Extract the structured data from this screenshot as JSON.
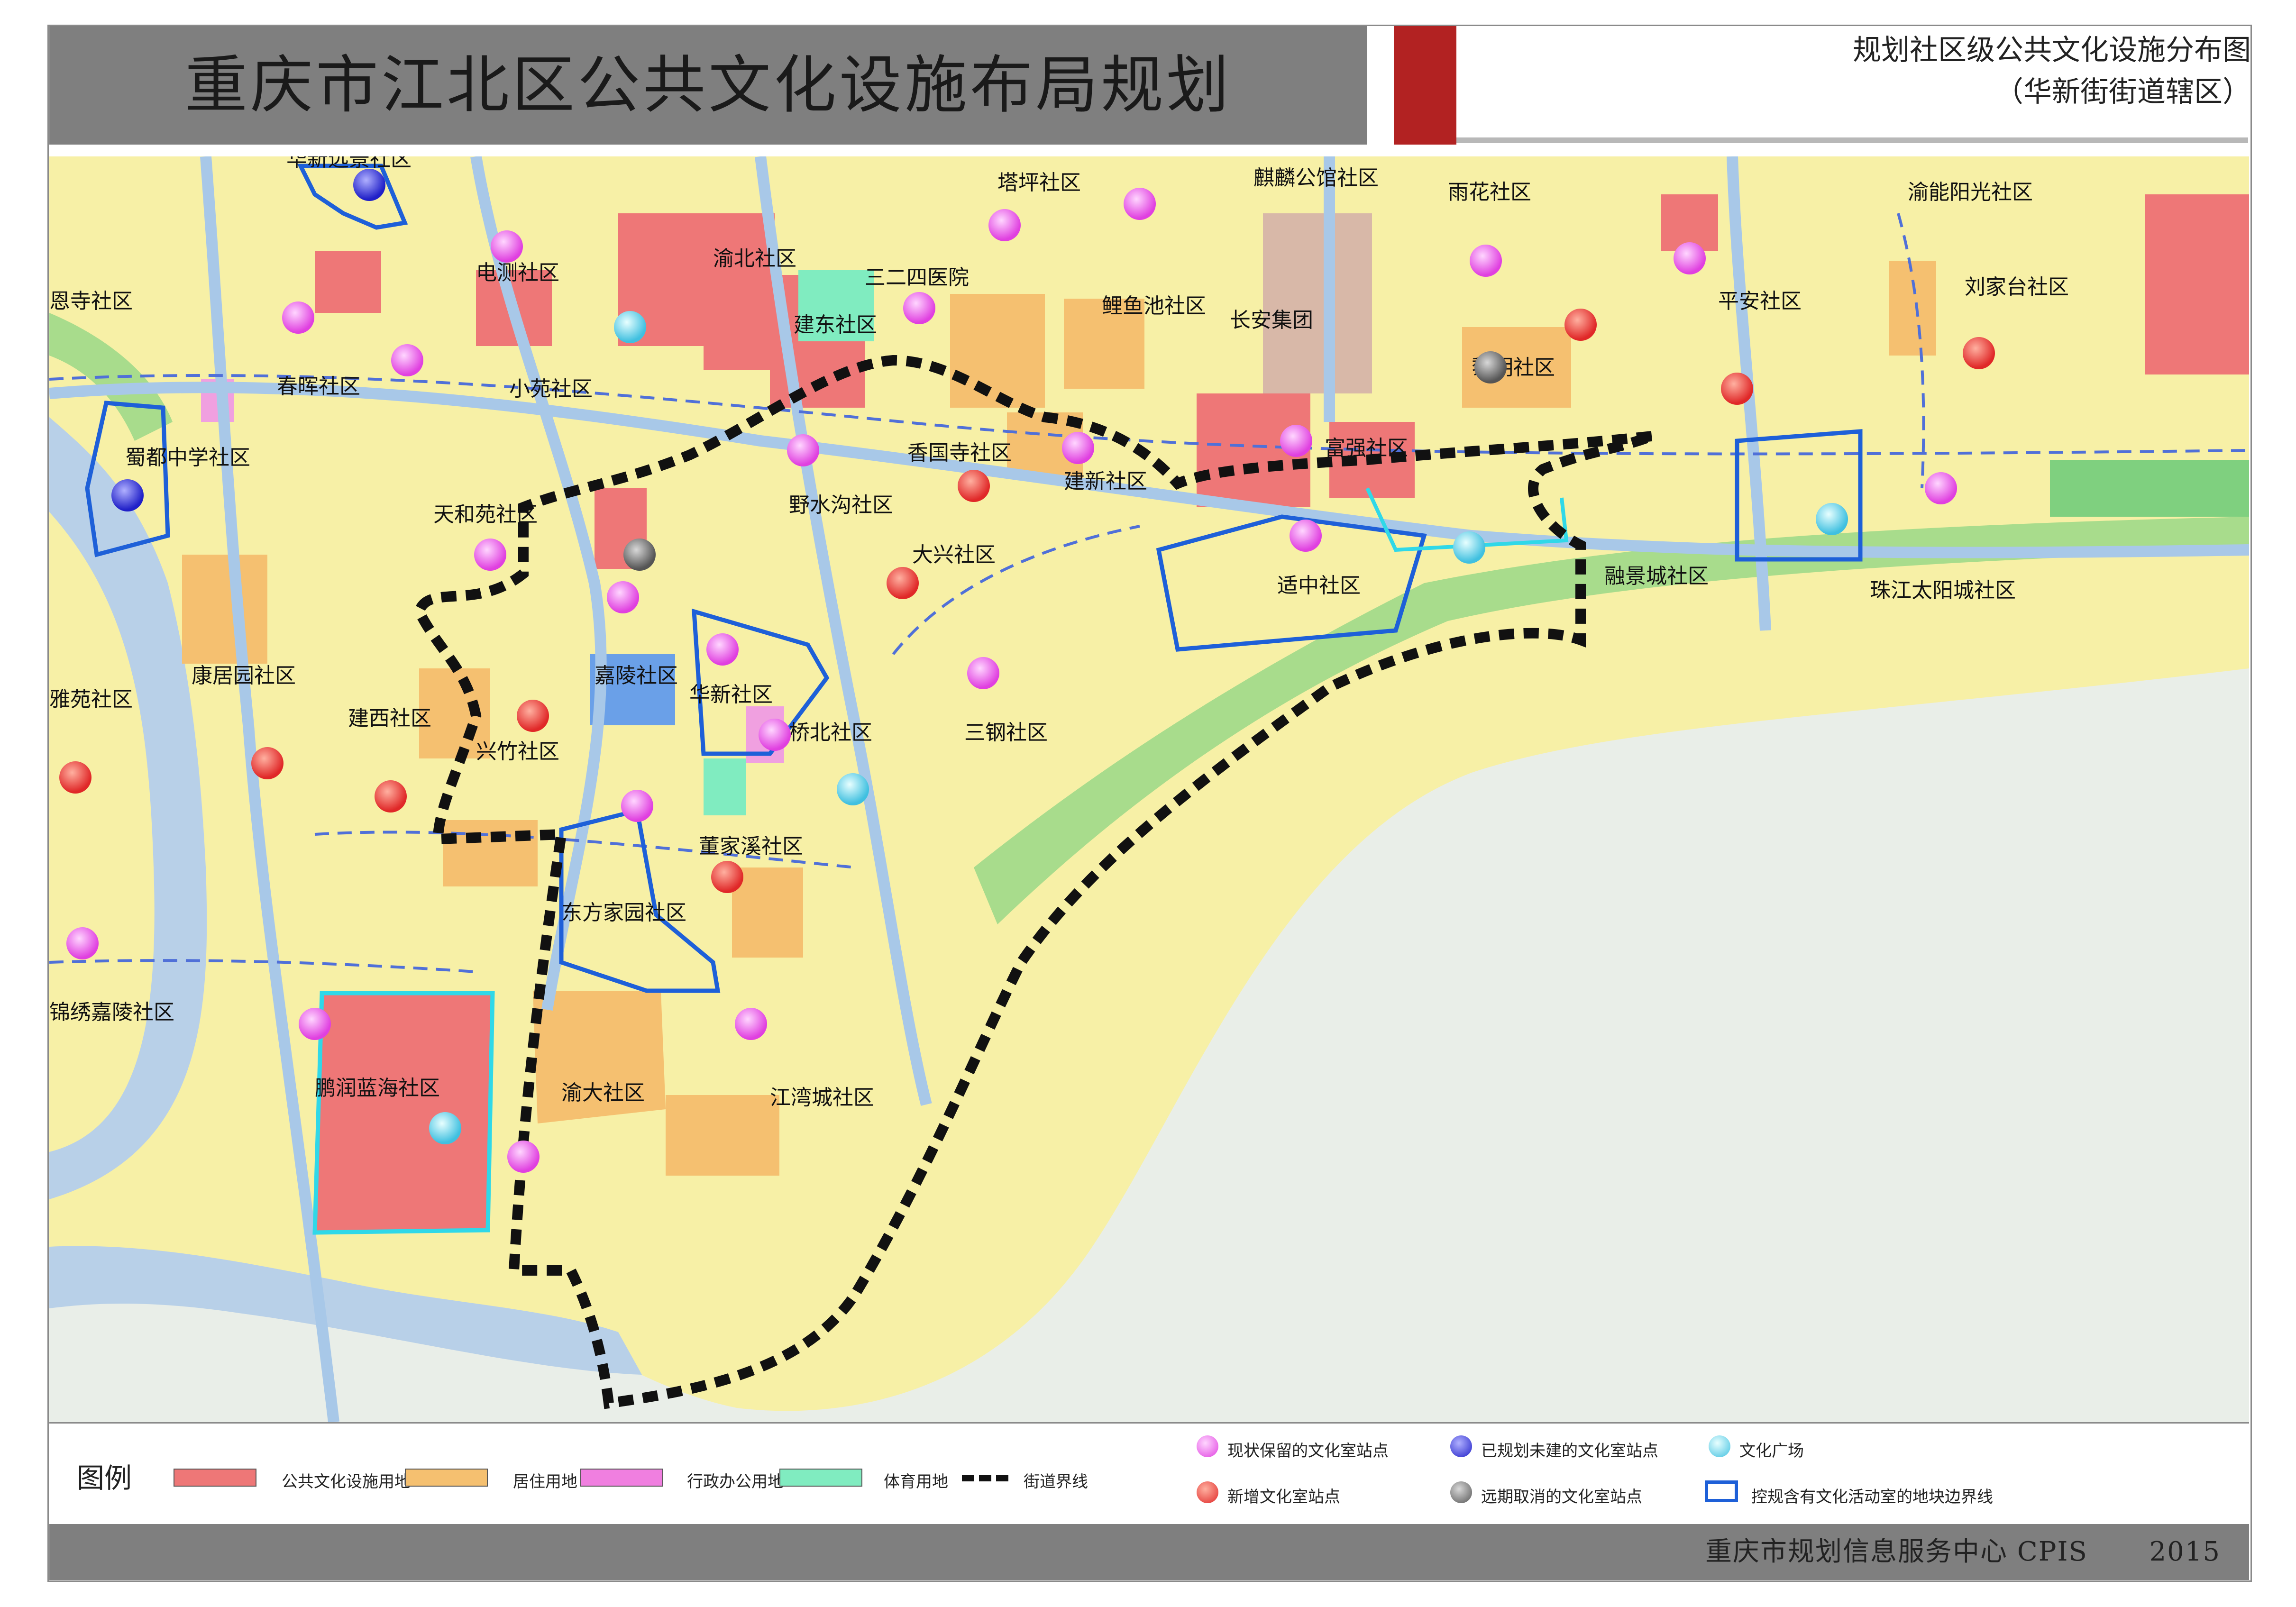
{
  "title": "重庆市江北区公共文化设施布局规划",
  "subtitle": {
    "line1": "规划社区级公共文化设施分布图",
    "line2": "（华新街街道辖区）"
  },
  "accent_color": "#b22222",
  "map": {
    "land_colors": {
      "residential": "#f7f0a6",
      "culture": "#ee7777",
      "housing": "#f5c070",
      "admin": "#f0a0e0",
      "sport": "#80ecc0",
      "green": "#a8dc8c",
      "water": "#d8e6d8"
    },
    "community_labels": [
      "华新远景社区",
      "塔坪社区",
      "麒麟公馆社区",
      "雨花社区",
      "渝能阳光社区",
      "电测社区",
      "渝北社区",
      "三二四医院",
      "恩寺社区",
      "建东社区",
      "鲤鱼池社区",
      "长安集团",
      "平安社区",
      "刘家台社区",
      "春晖社区",
      "小苑社区",
      "黎明社区",
      "蜀都中学社区",
      "香国寺社区",
      "富强社区",
      "建新社区",
      "野水沟社区",
      "天和苑社区",
      "大兴社区",
      "适中社区",
      "融景城社区",
      "珠江太阳城社区",
      "嘉陵社区",
      "华新社区",
      "康居园社区",
      "雅苑社区",
      "三钢社区",
      "建西社区",
      "桥北社区",
      "兴竹社区",
      "董家溪社区",
      "东方家园社区",
      "锦绣嘉陵社区",
      "鹏润蓝海社区",
      "渝大社区",
      "江湾城社区"
    ]
  },
  "legend": {
    "title": "图例",
    "items": [
      {
        "label": "公共文化设施用地",
        "color": "#ee7777"
      },
      {
        "label": "居住用地",
        "color": "#f5c070"
      },
      {
        "label": "行政办公用地",
        "color": "#f07fe0"
      },
      {
        "label": "体育用地",
        "color": "#80ecc0"
      },
      {
        "label": "街道界线",
        "color": "#111111"
      }
    ],
    "points": [
      {
        "label": "现状保留的文化室站点",
        "color": "#e040e0"
      },
      {
        "label": "已规划未建的文化室站点",
        "color": "#2a2ad8"
      },
      {
        "label": "文化广场",
        "color": "#40c8e0"
      },
      {
        "label": "新增文化室站点",
        "color": "#e02828"
      },
      {
        "label": "远期取消的文化室站点",
        "color": "#666666"
      },
      {
        "label": "控规含有文化活动室的地块边界线",
        "color": "#1e60d8"
      }
    ]
  },
  "footer": {
    "org": "重庆市规划信息服务中心 CPIS",
    "year": "2015"
  }
}
